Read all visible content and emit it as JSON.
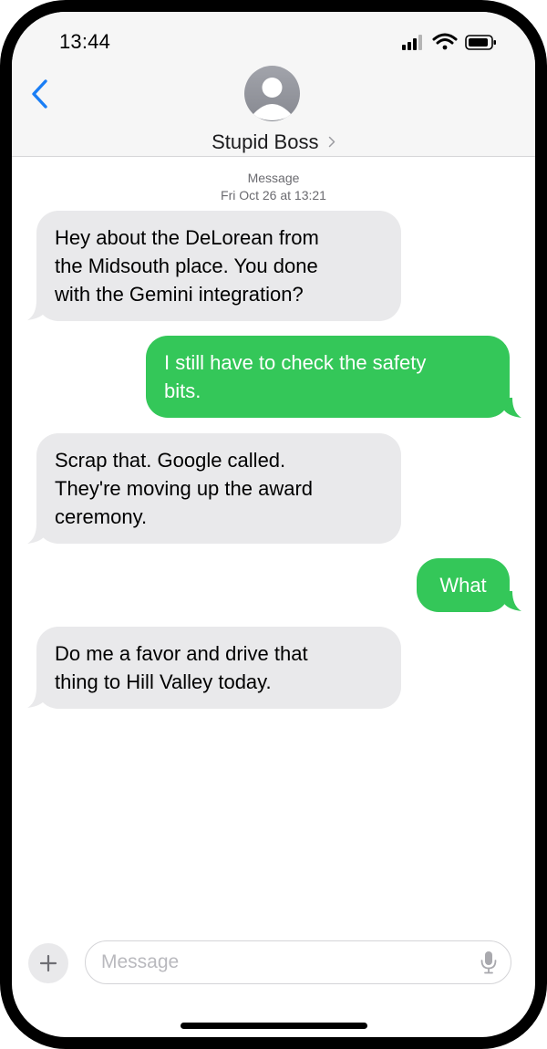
{
  "status_bar": {
    "time": "13:44",
    "icons": [
      "signal-icon",
      "wifi-icon",
      "battery-icon"
    ]
  },
  "header": {
    "back_icon": "chevron-left-icon",
    "contact_name": "Stupid Boss",
    "avatar_icon": "person-silhouette-icon"
  },
  "conversation": {
    "service_label": "Message",
    "timestamp": "Fri Oct 26 at 13:21",
    "messages": [
      {
        "direction": "incoming",
        "lines": [
          "Hey about the DeLorean from",
          "the Midsouth place. You done",
          "with the Gemini integration?"
        ]
      },
      {
        "direction": "outgoing",
        "lines": [
          "I still have to check the safety",
          "bits."
        ]
      },
      {
        "direction": "incoming",
        "lines": [
          "Scrap that. Google called.",
          "They're moving up the award",
          "ceremony."
        ]
      },
      {
        "direction": "outgoing",
        "lines": [
          "What"
        ]
      },
      {
        "direction": "incoming",
        "lines": [
          "Do me a favor and drive that",
          "thing to Hill Valley today."
        ]
      }
    ]
  },
  "composer": {
    "plus_label": "+",
    "placeholder": "Message",
    "mic_icon": "microphone-icon"
  },
  "colors": {
    "incoming_bubble": "#e9e9eb",
    "outgoing_bubble": "#34c759",
    "accent_blue": "#1a7ef5"
  }
}
